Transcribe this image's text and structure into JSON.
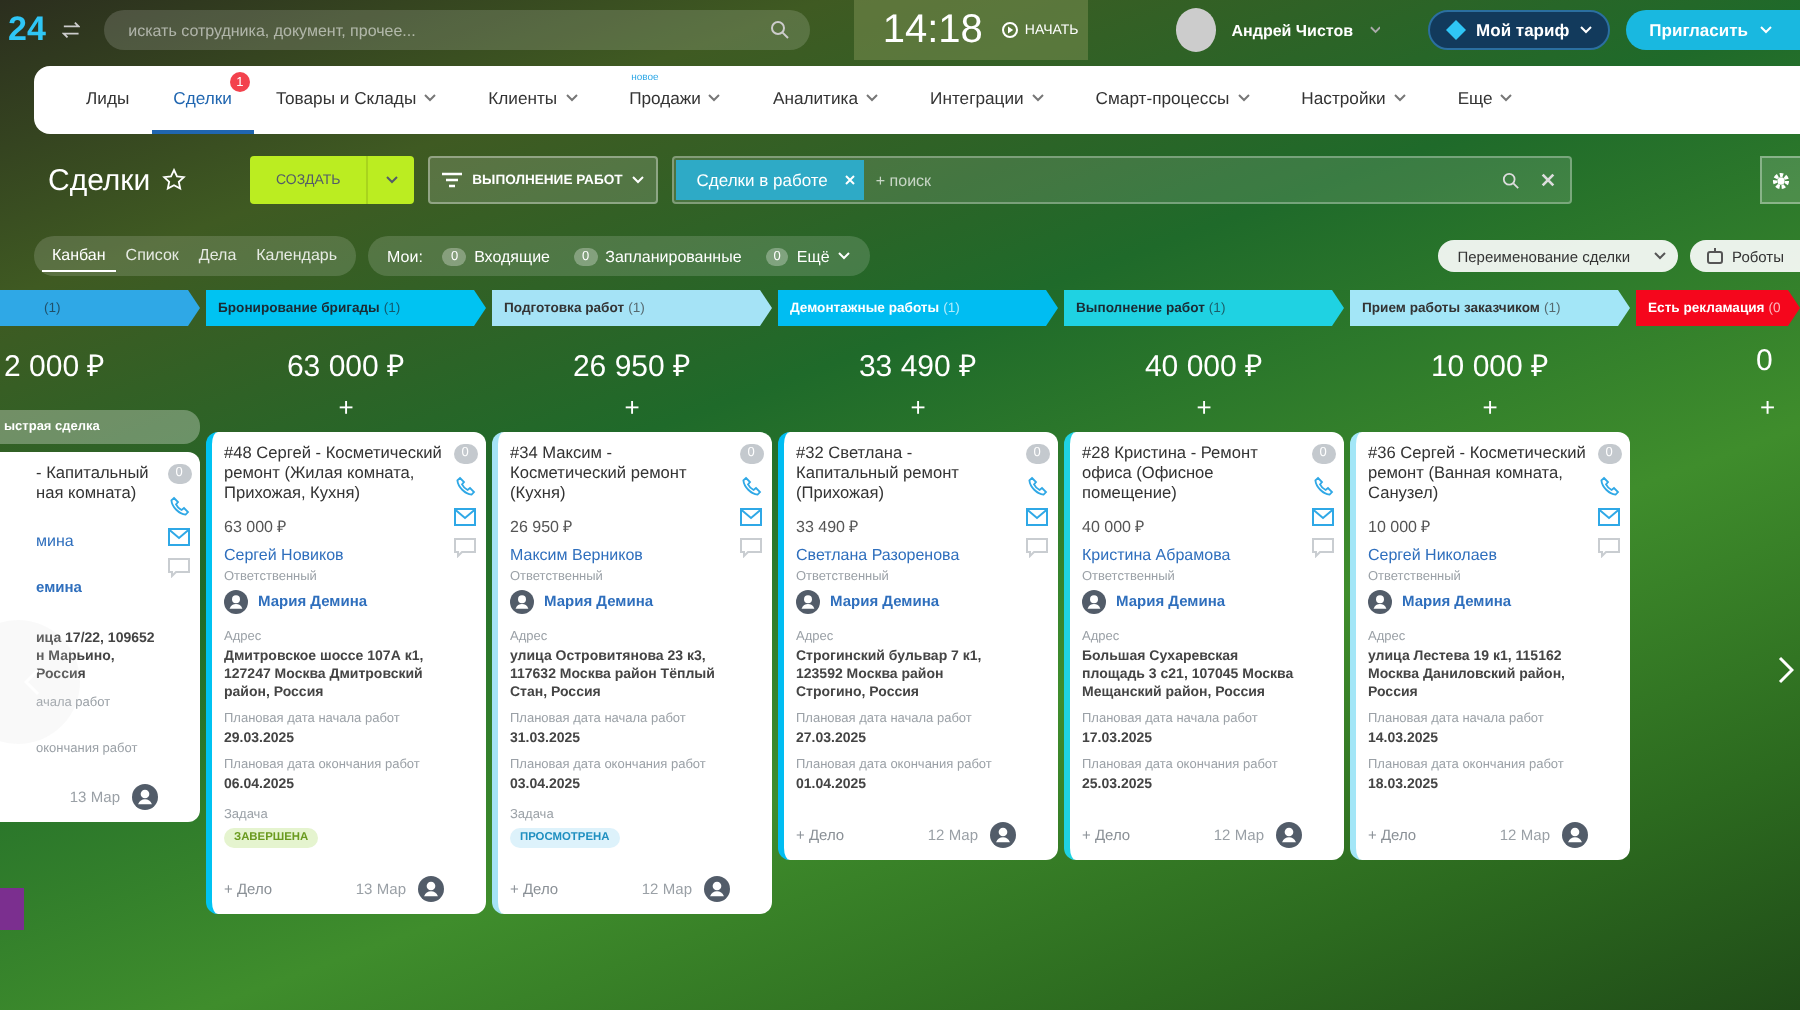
{
  "topbar": {
    "logo": "24",
    "search": {
      "placeholder": "искать сотрудника, документ, прочее..."
    },
    "time": "14:18",
    "start_button": "НАЧАТЬ",
    "user": "Андрей Чистов",
    "plan_button": "Мой тариф",
    "invite_button": "Пригласить"
  },
  "nav": [
    {
      "label": "Лиды",
      "selected": false,
      "menu": false
    },
    {
      "label": "Сделки",
      "selected": true,
      "menu": false,
      "badge": "1"
    },
    {
      "label": "Товары и Склады",
      "selected": false,
      "menu": true
    },
    {
      "label": "Клиенты",
      "selected": false,
      "menu": true
    },
    {
      "label": "Продажи",
      "selected": false,
      "menu": true,
      "tag": "новое"
    },
    {
      "label": "Аналитика",
      "selected": false,
      "menu": true
    },
    {
      "label": "Интеграции",
      "selected": false,
      "menu": true
    },
    {
      "label": "Смарт-процессы",
      "selected": false,
      "menu": true
    },
    {
      "label": "Настройки",
      "selected": false,
      "menu": true
    },
    {
      "label": "Еще",
      "selected": false,
      "menu": true
    }
  ],
  "toolbar": {
    "title": "Сделки",
    "create_button": "СОЗДАТЬ",
    "pipeline": "ВЫПОЛНЕНИЕ РАБОТ",
    "filter_tag": "Сделки в работе",
    "search_placeholder": "+ поиск"
  },
  "views": [
    {
      "label": "Канбан",
      "selected": true
    },
    {
      "label": "Список",
      "selected": false
    },
    {
      "label": "Дела",
      "selected": false
    },
    {
      "label": "Календарь",
      "selected": false
    }
  ],
  "counters": {
    "label": "Мои:",
    "items": [
      {
        "count": "0",
        "label": "Входящие",
        "menu": false
      },
      {
        "count": "0",
        "label": "Запланированные",
        "menu": false
      },
      {
        "count": "0",
        "label": "Ещё",
        "menu": true
      }
    ]
  },
  "rename_button": "Переименование сделки",
  "robots_button": "Роботы",
  "columns": [
    {
      "count": "(1)",
      "color": "#2fa8e6",
      "total": "2 000 ₽",
      "quick_deal": "ыстрая сделка",
      "partial": true,
      "cards": [
        {
          "title": "- Капитальный ная комната)",
          "client": "мина",
          "responsible": "емина",
          "address": "ица 17/22, 109652 н Марьино, Россия",
          "start_label": "ачала работ",
          "end_label": "окончания работ",
          "date": "13 Мар",
          "badge": "0"
        }
      ]
    },
    {
      "title": "Бронирование бригады",
      "count": "(1)",
      "color": "#00c3f2",
      "total": "63 000 ₽",
      "add_label": "+",
      "cards": [
        {
          "title": "#48 Сергей - Косметический ремонт (Жилая комната, Прихожая, Кухня)",
          "amount": "63 000 ₽",
          "client": "Сергей Новиков",
          "responsible_label": "Ответственный",
          "responsible": "Мария Демина",
          "address_label": "Адрес",
          "address": "Дмитровское шоссе 107А к1, 127247 Москва Дмитровский район, Россия",
          "start_label": "Плановая дата начала работ",
          "start": "29.03.2025",
          "end_label": "Плановая дата окончания работ",
          "end": "06.04.2025",
          "task_label": "Задача",
          "task": {
            "label": "ЗАВЕРШЕНА",
            "kind": "done"
          },
          "add": "+ Дело",
          "date": "13 Мар",
          "badge": "0"
        }
      ]
    },
    {
      "title": "Подготовка работ",
      "count": "(1)",
      "color": "#a5e3f6",
      "total": "26 950 ₽",
      "add_label": "+",
      "cards": [
        {
          "title": "#34 Максим - Косметический ремонт (Кухня)",
          "amount": "26 950 ₽",
          "client": "Максим Верников",
          "responsible_label": "Ответственный",
          "responsible": "Мария Демина",
          "address_label": "Адрес",
          "address": "улица Островитянова 23 к3, 117632 Москва район Тёплый Стан, Россия",
          "start_label": "Плановая дата начала работ",
          "start": "31.03.2025",
          "end_label": "Плановая дата окончания работ",
          "end": "03.04.2025",
          "task_label": "Задача",
          "task": {
            "label": "ПРОСМОТРЕНА",
            "kind": "seen"
          },
          "add": "+ Дело",
          "date": "12 Мар",
          "badge": "0"
        }
      ]
    },
    {
      "title": "Демонтажные работы",
      "count": "(1)",
      "color": "#00bdf2",
      "total": "33 490 ₽",
      "add_label": "+",
      "cards": [
        {
          "title": "#32 Светлана - Капитальный ремонт (Прихожая)",
          "amount": "33 490 ₽",
          "client": "Светлана Разоренова",
          "responsible_label": "Ответственный",
          "responsible": "Мария Демина",
          "address_label": "Адрес",
          "address": "Строгинский бульвар 7 к1, 123592 Москва район Строгино, Россия",
          "start_label": "Плановая дата начала работ",
          "start": "27.03.2025",
          "end_label": "Плановая дата окончания работ",
          "end": "01.04.2025",
          "add": "+ Дело",
          "date": "12 Мар",
          "badge": "0"
        }
      ]
    },
    {
      "title": "Выполнение работ",
      "count": "(1)",
      "color": "#1fd2e2",
      "total": "40 000 ₽",
      "add_label": "+",
      "cards": [
        {
          "title": "#28 Кристина - Ремонт офиса (Офисное помещение)",
          "amount": "40 000 ₽",
          "client": "Кристина Абрамова",
          "responsible_label": "Ответственный",
          "responsible": "Мария Демина",
          "address_label": "Адрес",
          "address": "Большая Сухаревская площадь 3 с21, 107045 Москва Мещанский район, Россия",
          "start_label": "Плановая дата начала работ",
          "start": "17.03.2025",
          "end_label": "Плановая дата окончания работ",
          "end": "25.03.2025",
          "add": "+ Дело",
          "date": "12 Мар",
          "badge": "0"
        }
      ]
    },
    {
      "title": "Прием работы заказчиком",
      "count": "(1)",
      "color": "#a3e6f7",
      "total": "10 000 ₽",
      "add_label": "+",
      "cards": [
        {
          "title": "#36 Сергей - Косметический ремонт (Ванная комната, Санузел)",
          "amount": "10 000 ₽",
          "client": "Сергей Николаев",
          "responsible_label": "Ответственный",
          "responsible": "Мария Демина",
          "address_label": "Адрес",
          "address": "улица Лестева 19 к1, 115162 Москва Даниловский район, Россия",
          "start_label": "Плановая дата начала работ",
          "start": "14.03.2025",
          "end_label": "Плановая дата окончания работ",
          "end": "18.03.2025",
          "add": "+ Дело",
          "date": "12 Мар",
          "badge": "0"
        }
      ]
    },
    {
      "title": "Есть рекламация",
      "count": "(0",
      "color": "#f5061c",
      "total": "0",
      "add_label": "+",
      "partial": true
    }
  ]
}
